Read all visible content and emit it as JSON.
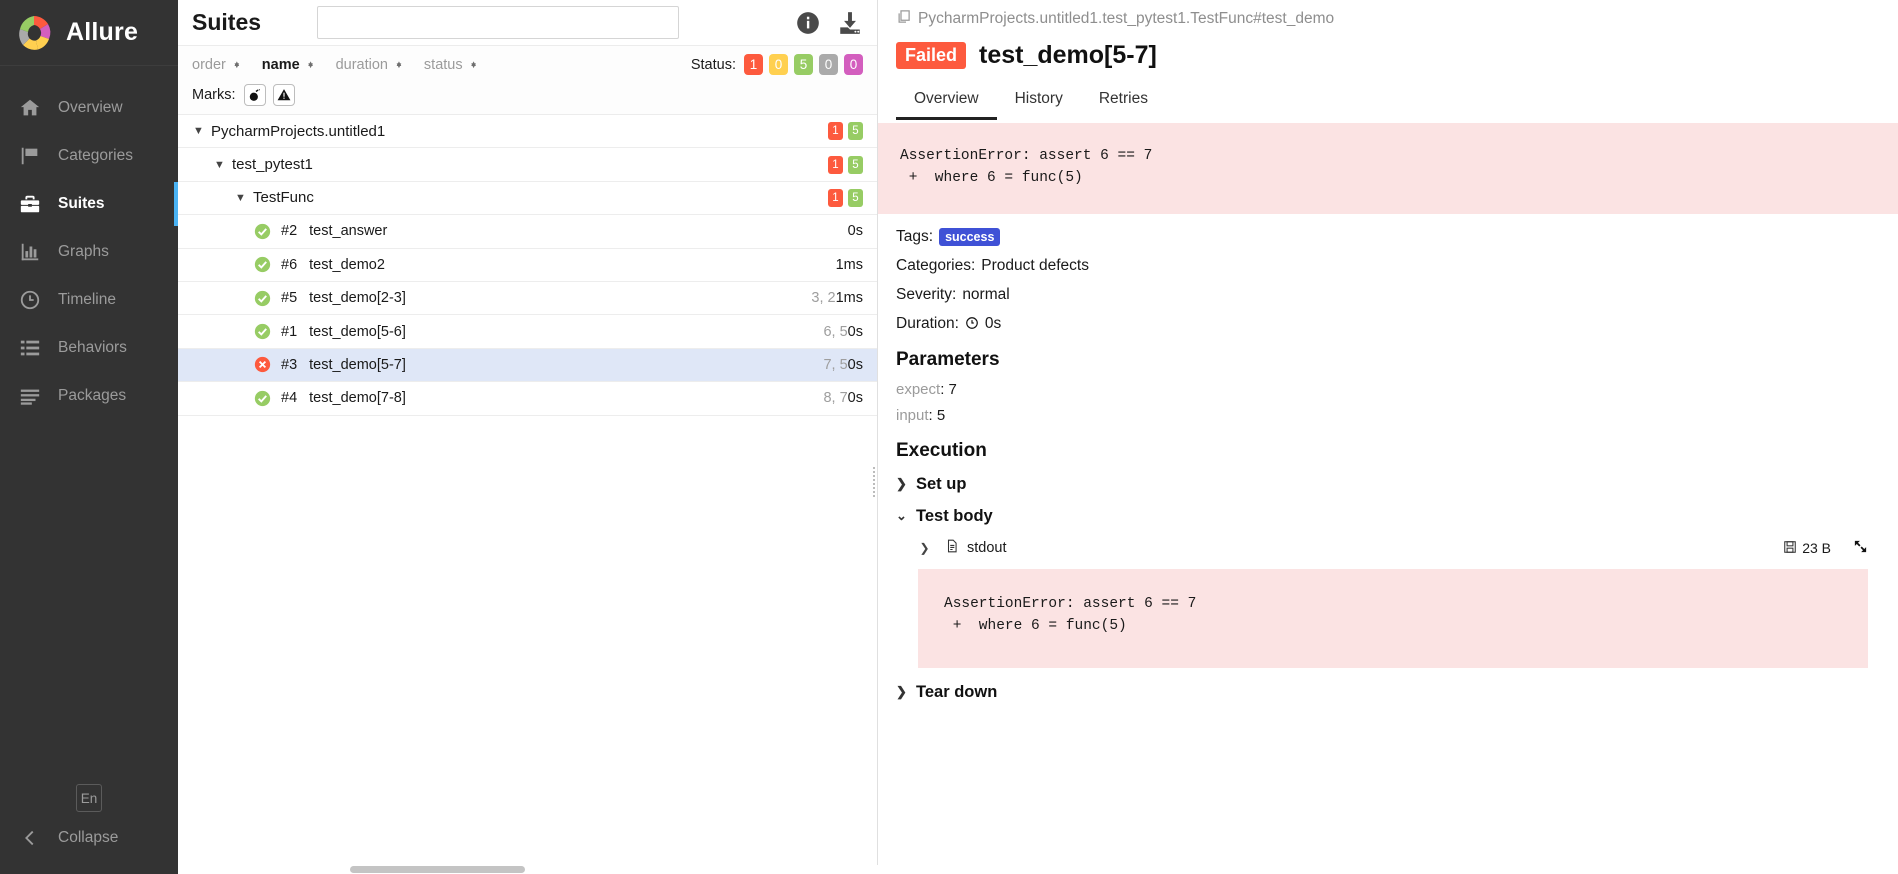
{
  "sidebar": {
    "brand": "Allure",
    "items": [
      {
        "label": "Overview",
        "icon": "home-icon"
      },
      {
        "label": "Categories",
        "icon": "flag-icon"
      },
      {
        "label": "Suites",
        "icon": "briefcase-icon"
      },
      {
        "label": "Graphs",
        "icon": "bar-chart-icon"
      },
      {
        "label": "Timeline",
        "icon": "clock-icon"
      },
      {
        "label": "Behaviors",
        "icon": "list-icon"
      },
      {
        "label": "Packages",
        "icon": "lines-icon"
      }
    ],
    "active_index": 2,
    "language": "En",
    "collapse": "Collapse"
  },
  "suites": {
    "title": "Suites",
    "search_value": "",
    "search_placeholder": "",
    "info_icon": "info-icon",
    "download_icon": "download-icon",
    "sorters": [
      {
        "label": "order",
        "active": false
      },
      {
        "label": "name",
        "active": true
      },
      {
        "label": "duration",
        "active": false
      },
      {
        "label": "status",
        "active": false
      }
    ],
    "status_label": "Status:",
    "status_badges": [
      {
        "count": "1",
        "color": "#fd5a3e",
        "name": "failed"
      },
      {
        "count": "0",
        "color": "#ffd050",
        "name": "broken"
      },
      {
        "count": "5",
        "color": "#97cc64",
        "name": "passed"
      },
      {
        "count": "0",
        "color": "#aaaaaa",
        "name": "skipped"
      },
      {
        "count": "0",
        "color": "#d35ebe",
        "name": "unknown"
      }
    ],
    "marks_label": "Marks:",
    "marks": [
      {
        "name": "flaky-bomb-icon"
      },
      {
        "name": "warning-triangle-icon"
      }
    ],
    "tree": [
      {
        "type": "group",
        "depth": 0,
        "label": "PycharmProjects.untitled1",
        "expanded": true,
        "counts": [
          {
            "value": "1",
            "color": "#fd5a3e"
          },
          {
            "value": "5",
            "color": "#97cc64"
          }
        ]
      },
      {
        "type": "group",
        "depth": 1,
        "label": "test_pytest1",
        "expanded": true,
        "counts": [
          {
            "value": "1",
            "color": "#fd5a3e"
          },
          {
            "value": "5",
            "color": "#97cc64"
          }
        ]
      },
      {
        "type": "group",
        "depth": 2,
        "label": "TestFunc",
        "expanded": true,
        "counts": [
          {
            "value": "1",
            "color": "#fd5a3e"
          },
          {
            "value": "5",
            "color": "#97cc64"
          }
        ]
      },
      {
        "type": "test",
        "depth": 3,
        "status": "passed",
        "num": "#2",
        "label": "test_answer",
        "duration_dim": "",
        "duration": "0s",
        "selected": false
      },
      {
        "type": "test",
        "depth": 3,
        "status": "passed",
        "num": "#6",
        "label": "test_demo2",
        "duration_dim": "",
        "duration": "1ms",
        "selected": false
      },
      {
        "type": "test",
        "depth": 3,
        "status": "passed",
        "num": "#5",
        "label": "test_demo[2-3]",
        "duration_dim": "3, 2",
        "duration": "1ms",
        "selected": false
      },
      {
        "type": "test",
        "depth": 3,
        "status": "passed",
        "num": "#1",
        "label": "test_demo[5-6]",
        "duration_dim": "6, 5",
        "duration": "0s",
        "selected": false
      },
      {
        "type": "test",
        "depth": 3,
        "status": "failed",
        "num": "#3",
        "label": "test_demo[5-7]",
        "duration_dim": "7, 5",
        "duration": "0s",
        "selected": true
      },
      {
        "type": "test",
        "depth": 3,
        "status": "passed",
        "num": "#4",
        "label": "test_demo[7-8]",
        "duration_dim": "8, 7",
        "duration": "0s",
        "selected": false
      }
    ]
  },
  "detail": {
    "breadcrumb": "PycharmProjects.untitled1.test_pytest1.TestFunc#test_demo",
    "status_pill": "Failed",
    "status_color": "#fd5a3e",
    "title": "test_demo[5-7]",
    "tabs": [
      {
        "label": "Overview",
        "active": true
      },
      {
        "label": "History",
        "active": false
      },
      {
        "label": "Retries",
        "active": false
      }
    ],
    "error_message": "AssertionError: assert 6 == 7\n +  where 6 = func(5)",
    "meta": {
      "tags_label": "Tags:",
      "tags": [
        "success"
      ],
      "tag_color": "#3f51d6",
      "categories_label": "Categories:",
      "categories_value": "Product defects",
      "severity_label": "Severity:",
      "severity_value": "normal",
      "duration_label": "Duration:",
      "duration_value": "0s"
    },
    "parameters_title": "Parameters",
    "parameters": [
      {
        "key": "expect",
        "value": "7"
      },
      {
        "key": "input",
        "value": "5"
      }
    ],
    "execution_title": "Execution",
    "execution": [
      {
        "label": "Set up",
        "expanded": false
      },
      {
        "label": "Test body",
        "expanded": true
      },
      {
        "label": "Tear down",
        "expanded": false
      }
    ],
    "stdout": {
      "label": "stdout",
      "expanded": false,
      "size": "23 B",
      "save_icon": "save-icon",
      "expand_icon": "fullscreen-icon",
      "file_icon": "file-text-icon"
    },
    "stdout_error": "AssertionError: assert 6 == 7\n +  where 6 = func(5)"
  }
}
